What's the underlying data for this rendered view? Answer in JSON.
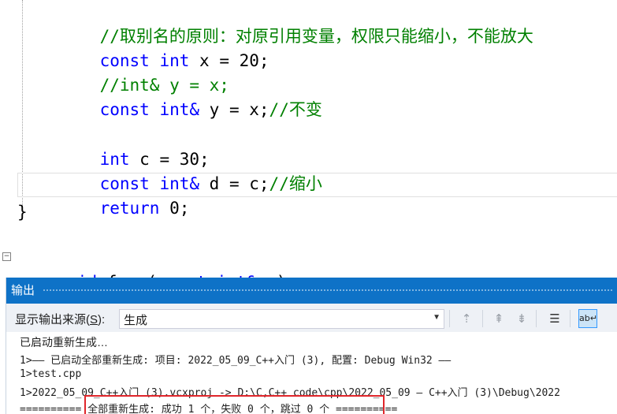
{
  "editor": {
    "lines": {
      "l1": {
        "comment": "//取别名的原则：对原引用变量，权限只能缩小，不能放大"
      },
      "l2": {
        "kw": "const",
        "kw2": "int",
        "rest": " x = 20;"
      },
      "l3": {
        "comment": "//int& y = x;"
      },
      "l4": {
        "kw": "const",
        "kw2": "int&",
        "rest": " y = x;",
        "comment": "//不变"
      },
      "l5": {
        "kw": "int",
        "rest": " c = 30;"
      },
      "l6": {
        "kw": "const",
        "kw2": "int&",
        "rest": " d = c;",
        "comment": "//缩小"
      },
      "l7": {
        "kw": "return",
        "rest": " 0;"
      }
    },
    "close_brace": "}",
    "collapse_glyph": "−",
    "func": {
      "kw": "void",
      "name": " func(",
      "kw2": "const",
      "kw3": "int&",
      "rest": " x)"
    }
  },
  "output_panel": {
    "title": "输出",
    "source_label_pre": "显示输出来源(",
    "source_label_key": "S",
    "source_label_post": "):",
    "source_value": "生成",
    "toolbar_icons": [
      "go-to-previous-icon",
      "go-to-next-icon",
      "find-next-icon",
      "clear-all-icon",
      "toggle-word-wrap-icon"
    ],
    "lines": [
      "已启动重新生成…",
      "1>—— 已启动全部重新生成: 项目: 2022_05_09_C++入门 (3), 配置: Debug Win32 ——",
      "1>test.cpp",
      "1>2022_05_09_C++入门 (3).vcxproj -> D:\\C,C++ code\\cpp\\2022_05_09 — C++入门 (3)\\Debug\\2022",
      "========== 全部重新生成: 成功 1 个，失败 0 个，跳过 0 个 =========="
    ]
  },
  "colors": {
    "keyword": "#0000ff",
    "comment": "#008000",
    "panel_title_bg": "#0e72c7",
    "highlight_border": "#e0262b"
  }
}
